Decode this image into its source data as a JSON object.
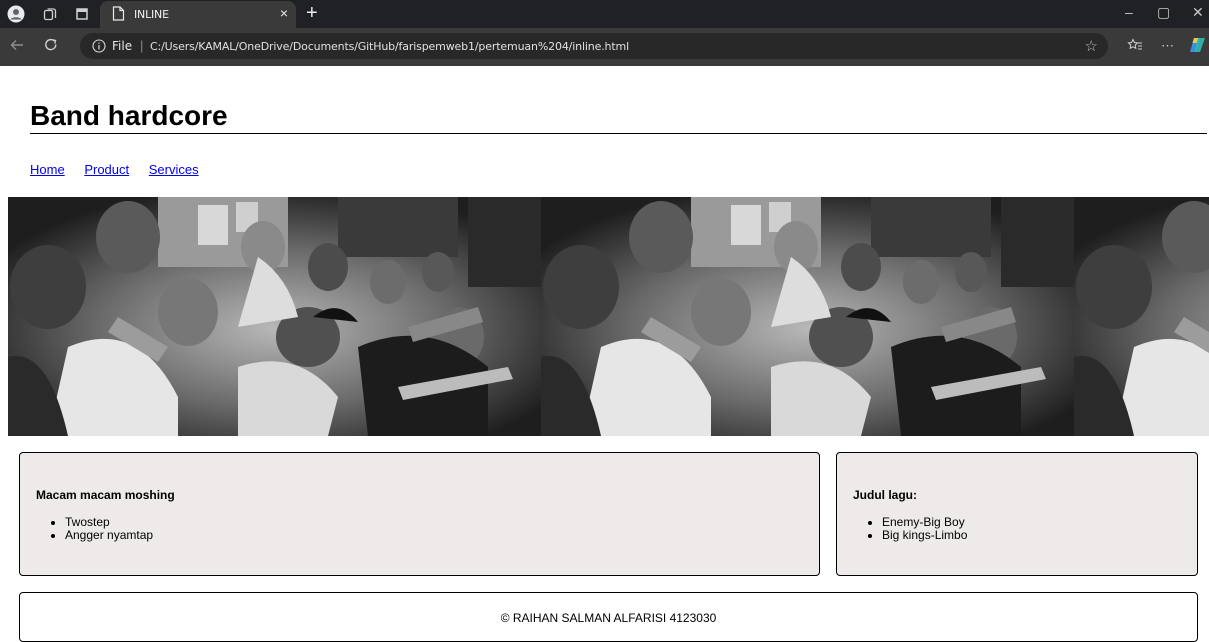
{
  "browser": {
    "tab_title": "INLINE",
    "tab_close": "×",
    "new_tab": "+",
    "url_scheme": "File",
    "url": "C:/Users/KAMAL/OneDrive/Documents/GitHub/farispemweb1/pertemuan%204/inline.html",
    "window_controls": [
      "–",
      "▢",
      "✕"
    ]
  },
  "page": {
    "title": "Band hardcore",
    "nav": [
      "Home",
      "Product",
      "Services"
    ],
    "banner_image": "black-and-white photo of a hardcore band crowd (mosh pit), tiled",
    "left_box": {
      "heading": "Macam macam moshing",
      "items": [
        "Twostep",
        "Angger nyamtap"
      ]
    },
    "right_box": {
      "heading": "Judul lagu:",
      "items": [
        "Enemy-Big Boy",
        "Big kings-Limbo"
      ]
    },
    "footer": "© RAIHAN SALMAN ALFARISI 4123030"
  },
  "colors": {
    "link": "#0000ee",
    "box_bg": "#eeeaea",
    "chrome_dark": "#202124",
    "chrome_bar": "#3a3a3a"
  }
}
